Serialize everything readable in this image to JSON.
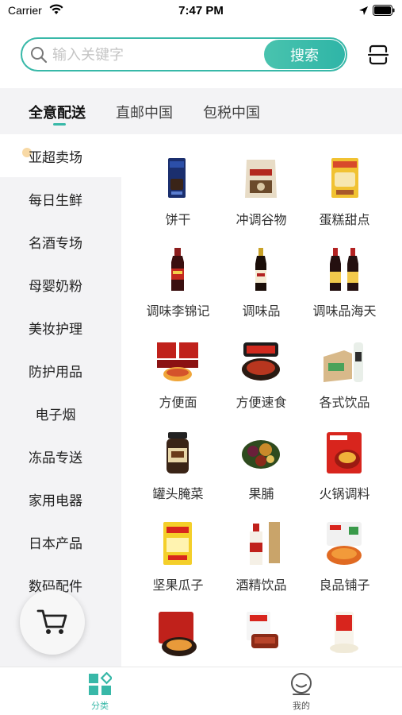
{
  "status_bar": {
    "carrier": "Carrier",
    "time": "7:47 PM"
  },
  "search": {
    "placeholder": "输入关键字",
    "value": "",
    "button_label": "搜索"
  },
  "tabs": [
    {
      "label": "全意配送",
      "active": true
    },
    {
      "label": "直邮中国",
      "active": false
    },
    {
      "label": "包税中国",
      "active": false
    }
  ],
  "sidebar": {
    "items": [
      {
        "label": "亚超卖场",
        "active": true
      },
      {
        "label": "每日生鲜"
      },
      {
        "label": "名酒专场"
      },
      {
        "label": "母婴奶粉"
      },
      {
        "label": "美妆护理"
      },
      {
        "label": "防护用品"
      },
      {
        "label": "电子烟"
      },
      {
        "label": "冻品专送"
      },
      {
        "label": "家用电器"
      },
      {
        "label": "日本产品"
      },
      {
        "label": "数码配件"
      }
    ]
  },
  "products": [
    {
      "label": "饼干",
      "icon": "biscuit-box"
    },
    {
      "label": "冲调谷物",
      "icon": "cereal-bag"
    },
    {
      "label": "蛋糕甜点",
      "icon": "cake-pack"
    },
    {
      "label": "调味李锦记",
      "icon": "sauce-bottle"
    },
    {
      "label": "调味品",
      "icon": "soy-sauce-bottle"
    },
    {
      "label": "调味品海天",
      "icon": "twin-sauce-bottles"
    },
    {
      "label": "方便面",
      "icon": "instant-noodles"
    },
    {
      "label": "方便速食",
      "icon": "self-heating-hotpot"
    },
    {
      "label": "各式饮品",
      "icon": "drink-box"
    },
    {
      "label": "罐头腌菜",
      "icon": "pickle-jar"
    },
    {
      "label": "果脯",
      "icon": "dried-fruit"
    },
    {
      "label": "火锅调料",
      "icon": "hotpot-seasoning"
    },
    {
      "label": "坚果瓜子",
      "icon": "nuts-bag"
    },
    {
      "label": "酒精饮品",
      "icon": "liquor-bottle"
    },
    {
      "label": "良品铺子",
      "icon": "snack-bag"
    },
    {
      "label": "",
      "icon": "noodle-pack"
    },
    {
      "label": "",
      "icon": "meat-snack"
    },
    {
      "label": "",
      "icon": "rice-bag"
    }
  ],
  "bottom_nav": [
    {
      "label": "分类",
      "active": true,
      "icon": "category-icon"
    },
    {
      "label": "我的",
      "active": false,
      "icon": "profile-icon"
    }
  ],
  "colors": {
    "accent": "#38b8a8",
    "background_gray": "#f3f3f5"
  }
}
